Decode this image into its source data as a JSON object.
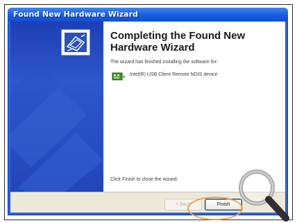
{
  "window": {
    "title": "Found New Hardware Wizard"
  },
  "content": {
    "heading": "Completing the Found New Hardware Wizard",
    "finished_text": "The wizard has finished installing the software for:",
    "device_name": "Intel(R) USB Client Remote NDIS device",
    "close_instruction": "Click Finish to close the wizard."
  },
  "footer": {
    "back_label": "< Back",
    "finish_label": "Finish"
  },
  "icons": {
    "wizard": "hardware-wizard-icon",
    "device": "network-device-icon",
    "magnifier": "magnifying-glass-icon"
  },
  "colors": {
    "title_bar": "#1c5ee0",
    "side_panel": "#2246b8",
    "highlight_ring": "#f2a24a"
  }
}
